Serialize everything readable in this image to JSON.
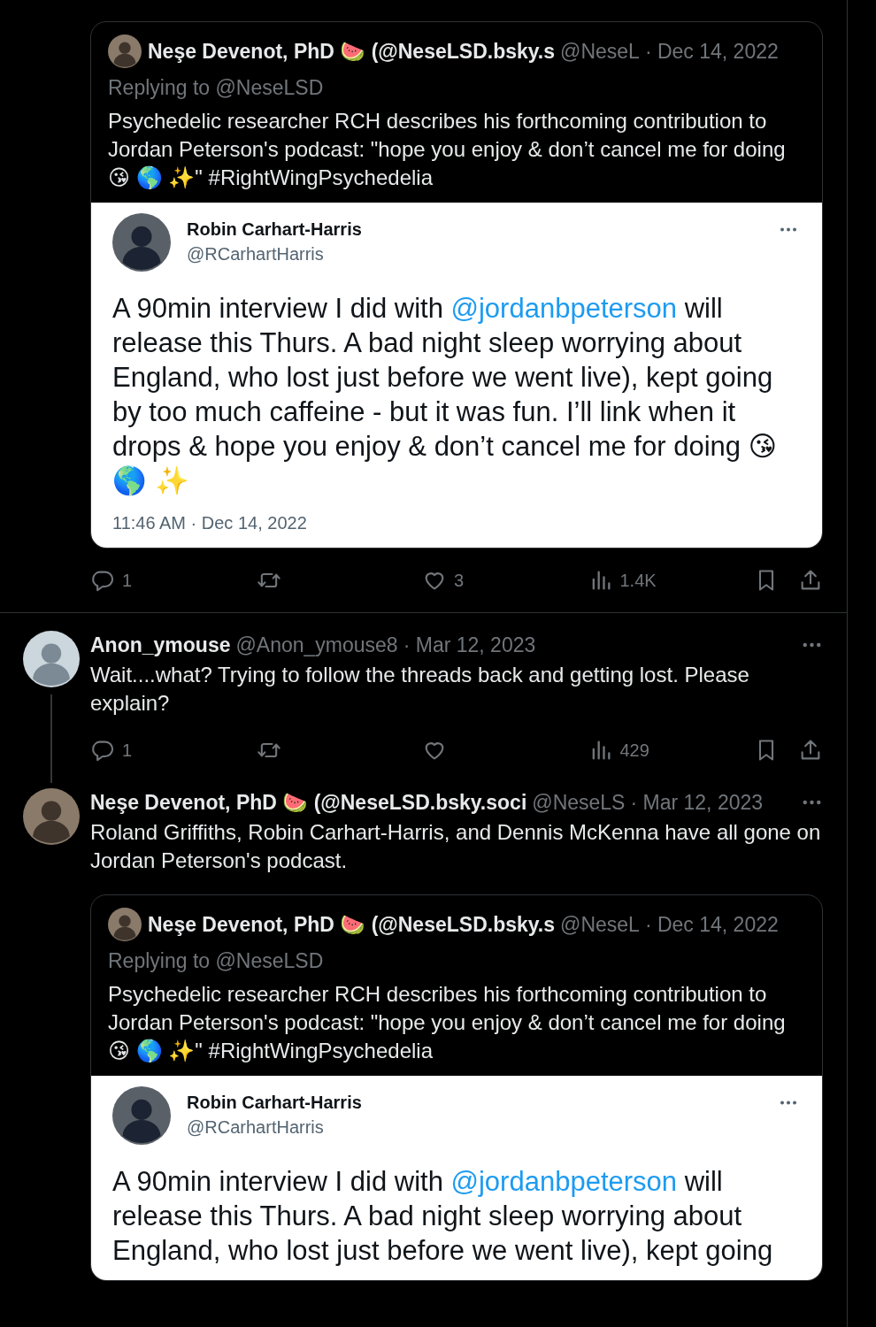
{
  "top_post": {
    "quote": {
      "author_name": "Neşe Devenot, PhD 🍉 (@NeseLSD.bsky.s",
      "author_handle": "@NeseL",
      "date": "· Dec 14, 2022",
      "replying_to": "Replying to @NeseLSD",
      "text": "Psychedelic researcher RCH describes his forthcoming contribution to Jordan Peterson's podcast: \"hope you enjoy & don’t cancel me for doing 😘 🌎 ✨\" #RightWingPsychedelia",
      "media": {
        "name": "Robin Carhart-Harris",
        "handle": "@RCarhartHarris",
        "text_before": "A 90min interview I did with ",
        "mention": "@jordanbpeterson",
        "text_after": " will release this Thurs. A bad night sleep  worrying about England, who lost just before we went live), kept going by too much caffeine - but it was fun. I’ll link when it drops & hope you enjoy & don’t cancel me for doing 😘 🌎 ✨",
        "timestamp": "11:46 AM · Dec 14, 2022"
      }
    },
    "actions": {
      "replies": "1",
      "likes": "3",
      "views": "1.4K"
    }
  },
  "replies": [
    {
      "has_photo": false,
      "author_name": "Anon_ymouse",
      "author_handle": "@Anon_ymouse8",
      "date": "· Mar 12, 2023",
      "text": "Wait....what? Trying to follow the threads back and getting lost. Please explain?",
      "thread_continues": true,
      "actions": {
        "replies": "1",
        "views": "429"
      }
    },
    {
      "has_photo": true,
      "author_name": "Neşe Devenot, PhD 🍉 (@NeseLSD.bsky.soci",
      "author_handle": "@NeseLS",
      "date": "· Mar 12, 2023",
      "text": "Roland Griffiths, Robin Carhart-Harris, and Dennis McKenna have all gone on Jordan Peterson's podcast.",
      "thread_continues": false,
      "quote": {
        "author_name": "Neşe Devenot, PhD 🍉 (@NeseLSD.bsky.s",
        "author_handle": "@NeseL",
        "date": "· Dec 14, 2022",
        "replying_to": "Replying to @NeseLSD",
        "text": "Psychedelic researcher RCH describes his forthcoming contribution to Jordan Peterson's podcast: \"hope you enjoy & don’t cancel me for doing 😘 🌎 ✨\" #RightWingPsychedelia",
        "media": {
          "name": "Robin Carhart-Harris",
          "handle": "@RCarhartHarris",
          "text_before": "A 90min interview I did with ",
          "mention": "@jordanbpeterson",
          "text_after": " will release this Thurs. A bad night sleep  worrying about England, who lost just before we went live), kept going"
        }
      }
    }
  ]
}
